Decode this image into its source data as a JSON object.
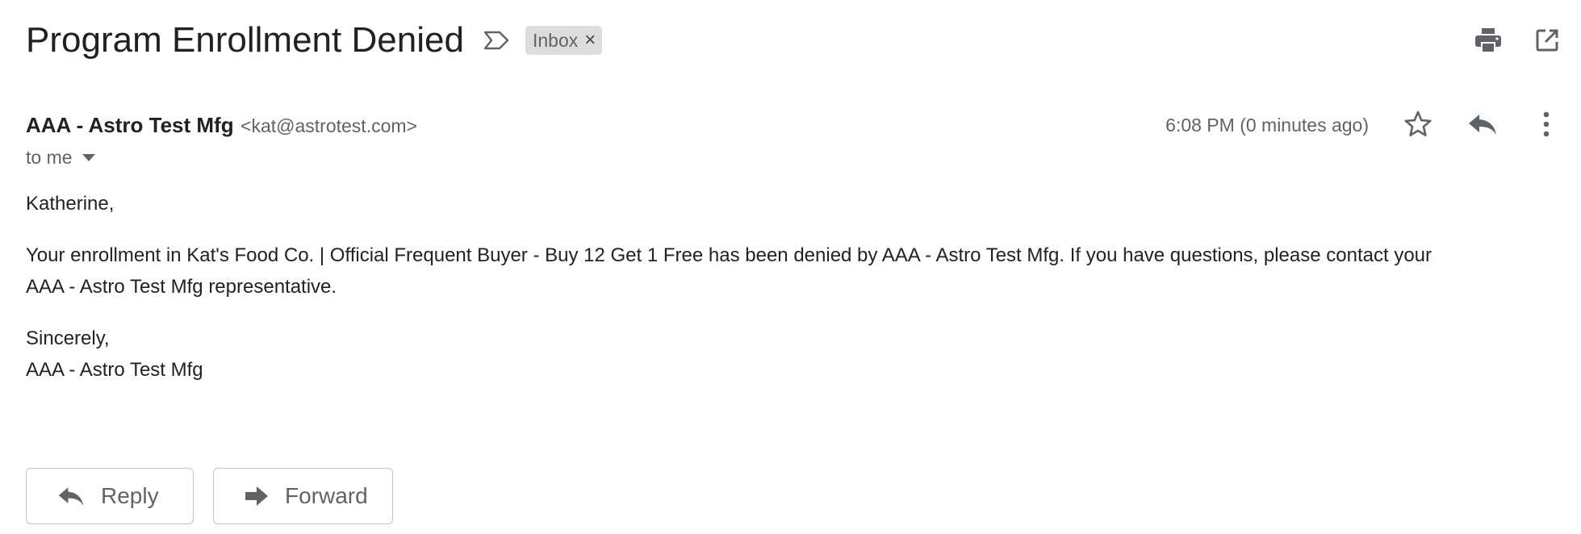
{
  "message": {
    "subject": "Program Enrollment Denied",
    "label": "Inbox",
    "label_remove": "×"
  },
  "icons": {
    "important": "important-marker-icon",
    "print": "print-icon",
    "open_new_window": "open-in-new-window-icon",
    "star": "star-icon",
    "reply": "reply-icon",
    "more": "more-vert-icon",
    "forward": "forward-icon"
  },
  "sender": {
    "name": "AAA - Astro Test Mfg",
    "email": "<kat@astrotest.com>",
    "recipient": "to me",
    "time": "6:08 PM (0 minutes ago)"
  },
  "body": {
    "greeting": "Katherine,",
    "paragraph_line1": "Your enrollment in Kat's Food Co. | Official Frequent Buyer - Buy 12 Get 1 Free has been denied by AAA - Astro Test Mfg. If you have questions, please contact your",
    "paragraph_line2": "AAA - Astro Test Mfg representative.",
    "closing": "Sincerely,",
    "signature": "AAA - Astro Test Mfg"
  },
  "actions": {
    "reply": "Reply",
    "forward": "Forward"
  },
  "colors": {
    "text_primary": "#202124",
    "text_secondary": "#5f6368",
    "icon": "#5f6368",
    "chip_bg": "#dddddd",
    "button_border": "#c4c4c4"
  }
}
